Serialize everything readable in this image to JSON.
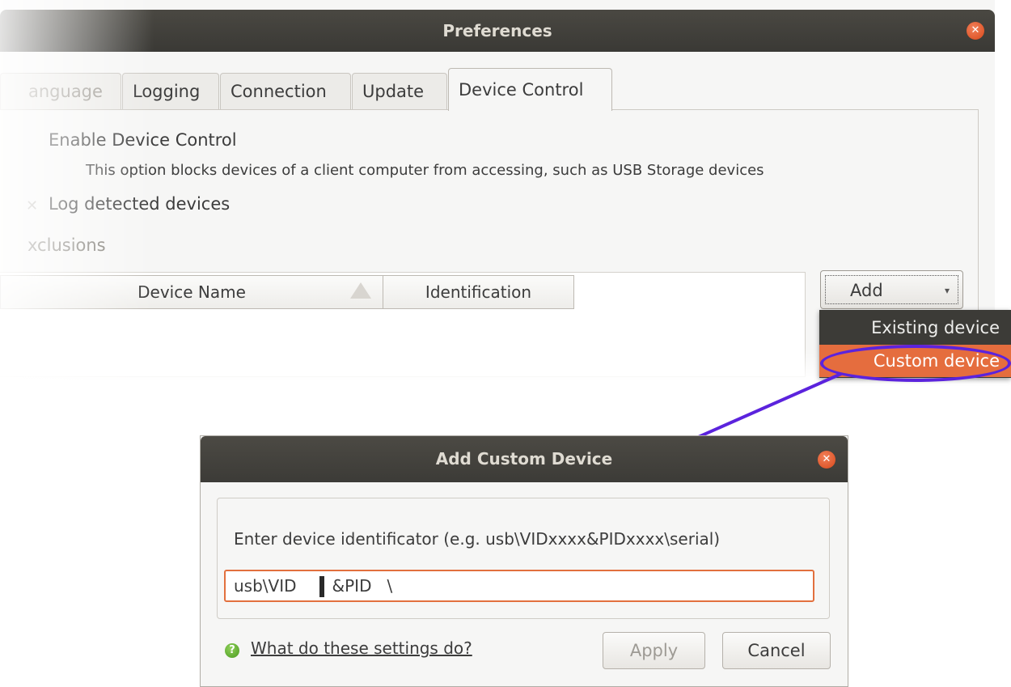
{
  "preferences": {
    "title": "Preferences",
    "tabs": [
      {
        "label": "anguage"
      },
      {
        "label": "Logging"
      },
      {
        "label": "Connection"
      },
      {
        "label": "Update"
      },
      {
        "label": "Device Control",
        "active": true
      }
    ],
    "enable_device_control": "Enable Device Control",
    "enable_description": "This option blocks devices of a client computer from accessing, such as USB Storage devices",
    "log_detected_devices": "Log detected devices",
    "exclusions_label": "xclusions",
    "columns": [
      "Device Name",
      "Identification"
    ],
    "add_button": "Add",
    "add_menu": [
      "Existing device",
      "Custom device"
    ]
  },
  "dialog": {
    "title": "Add Custom Device",
    "prompt": "Enter device identificator (e.g. usb\\VIDxxxx&PIDxxxx\\serial)",
    "input_part1": "usb\\VID",
    "input_part2": "&PID   \\",
    "help_link": "What do these settings do?",
    "apply": "Apply",
    "cancel": "Cancel"
  },
  "colors": {
    "accent": "#e56d3e",
    "annotation": "#5b23dd",
    "titlebar": "#3c3b37"
  },
  "icons": {
    "close": "close-icon",
    "help": "help-icon",
    "sort": "sort-ascending-icon",
    "dropdown": "chevron-down-icon"
  }
}
